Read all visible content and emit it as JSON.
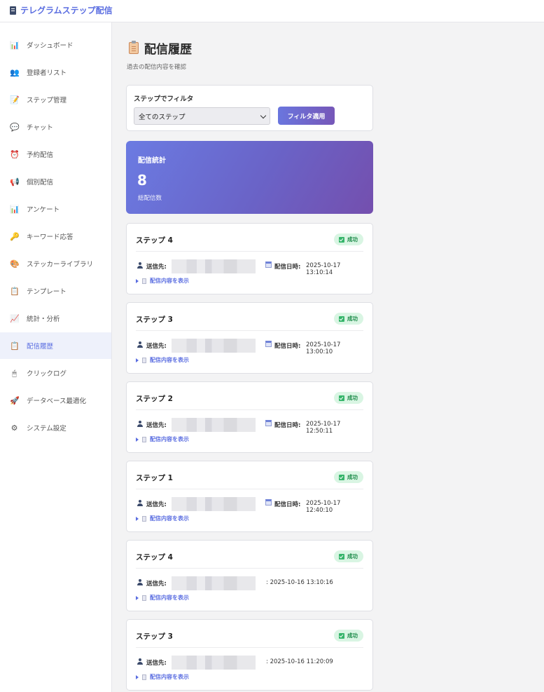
{
  "app": {
    "title": "テレグラムステップ配信"
  },
  "sidebar": {
    "items": [
      {
        "label": "ダッシュボード",
        "icon": "bar-chart-icon"
      },
      {
        "label": "登録者リスト",
        "icon": "users-icon"
      },
      {
        "label": "ステップ管理",
        "icon": "memo-icon"
      },
      {
        "label": "チャット",
        "icon": "chat-bubble-icon"
      },
      {
        "label": "予約配信",
        "icon": "alarm-clock-icon"
      },
      {
        "label": "個別配信",
        "icon": "megaphone-icon"
      },
      {
        "label": "アンケート",
        "icon": "bar-chart-icon"
      },
      {
        "label": "キーワード応答",
        "icon": "key-icon"
      },
      {
        "label": "ステッカーライブラリ",
        "icon": "palette-icon"
      },
      {
        "label": "テンプレート",
        "icon": "clipboard-icon"
      },
      {
        "label": "統計・分析",
        "icon": "line-chart-icon"
      },
      {
        "label": "配信履歴",
        "icon": "clipboard-icon",
        "active": true
      },
      {
        "label": "クリックログ",
        "icon": "mouse-icon"
      },
      {
        "label": "データベース最適化",
        "icon": "rocket-icon"
      },
      {
        "label": "システム設定",
        "icon": "gear-icon"
      }
    ]
  },
  "page": {
    "title": "配信履歴",
    "subtitle": "過去の配信内容を確認"
  },
  "filter": {
    "label": "ステップでフィルタ",
    "selected": "全てのステップ",
    "button": "フィルタ適用"
  },
  "stats": {
    "title": "配信統計",
    "value": "8",
    "label": "総配信数"
  },
  "labels": {
    "recipient": "送信先:",
    "sent_at": "配信日時:",
    "show_content": "配信内容を表示"
  },
  "history": [
    {
      "step": "ステップ 4",
      "status": "成功",
      "date": "2025-10-17 13:10:14",
      "date_label": true
    },
    {
      "step": "ステップ 3",
      "status": "成功",
      "date": "2025-10-17 13:00:10",
      "date_label": true
    },
    {
      "step": "ステップ 2",
      "status": "成功",
      "date": "2025-10-17 12:50:11",
      "date_label": true
    },
    {
      "step": "ステップ 1",
      "status": "成功",
      "date": "2025-10-17 12:40:10",
      "date_label": true
    },
    {
      "step": "ステップ 4",
      "status": "成功",
      "date": ": 2025-10-16 13:10:16",
      "date_label": false
    },
    {
      "step": "ステップ 3",
      "status": "成功",
      "date": ": 2025-10-16 11:20:09",
      "date_label": false
    }
  ]
}
